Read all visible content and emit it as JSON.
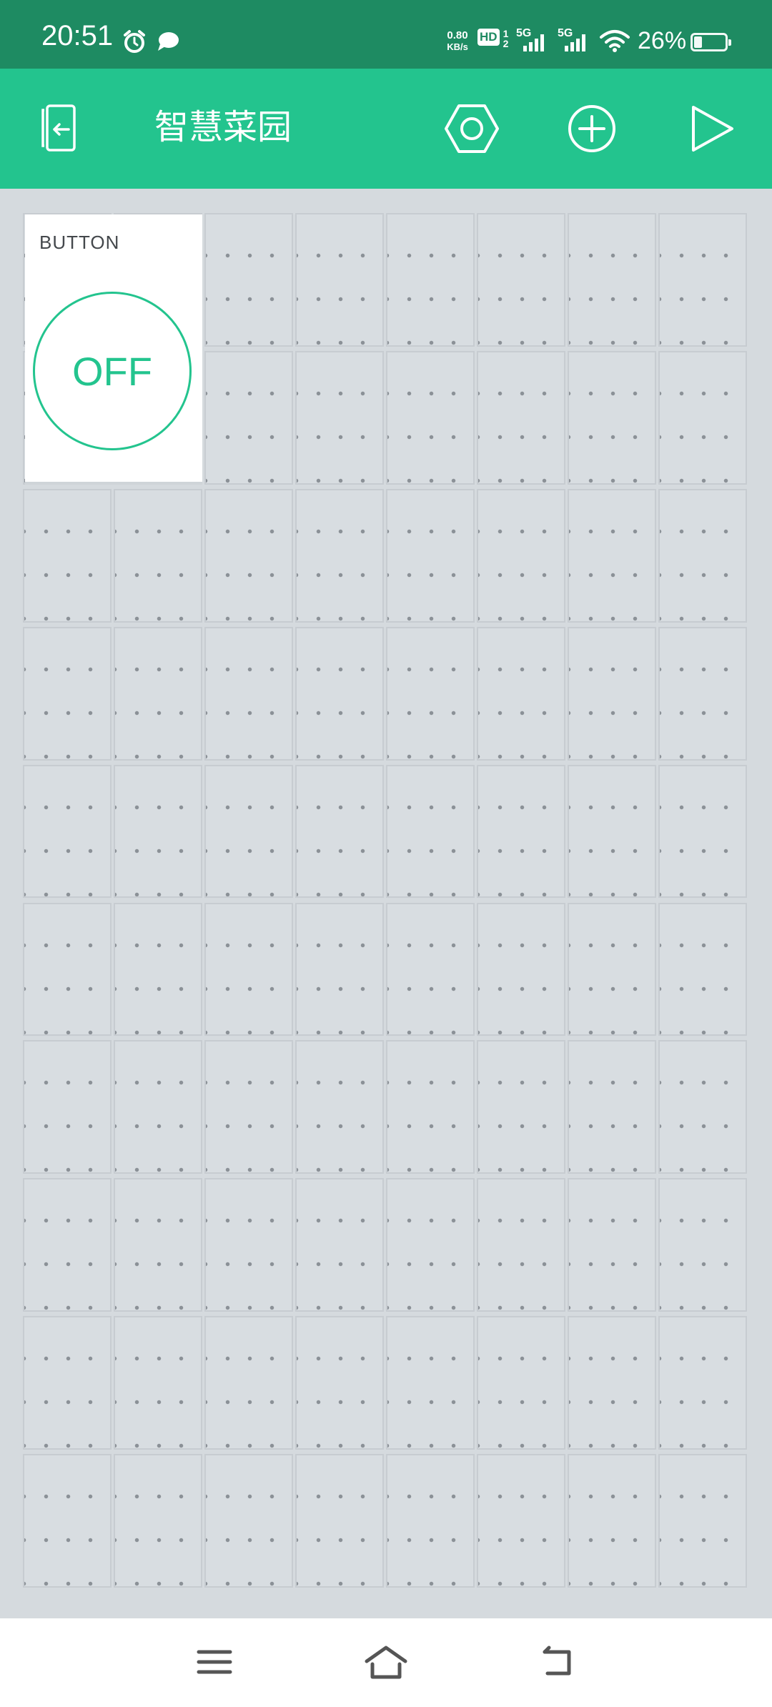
{
  "status_bar": {
    "time": "20:51",
    "net_speed_value": "0.80",
    "net_speed_unit": "KB/s",
    "hd_label": "HD",
    "hd_sub_top": "1",
    "hd_sub_bottom": "2",
    "sim1_label": "5G",
    "sim2_label": "5G",
    "battery": "26%",
    "icons": [
      "alarm-icon",
      "chat-bubble-icon",
      "wifi-icon",
      "battery-icon"
    ]
  },
  "app_bar": {
    "title": "智慧菜园",
    "icons": [
      "exit-device-icon",
      "settings-hexagon-icon",
      "add-widget-icon",
      "play-icon"
    ]
  },
  "widget": {
    "label": "BUTTON",
    "state": "OFF"
  },
  "nav_bar": {
    "icons": [
      "menu-icon",
      "home-icon",
      "back-icon"
    ]
  },
  "colors": {
    "status_bar": "#1e8b62",
    "app_bar": "#23c48e",
    "accent": "#23c48e",
    "canvas": "#d5dade"
  }
}
